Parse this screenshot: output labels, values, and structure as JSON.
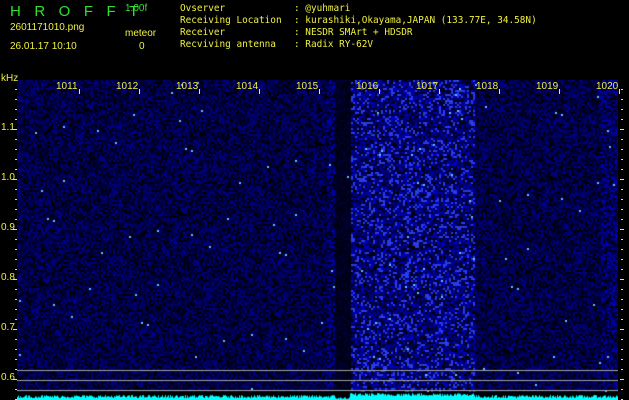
{
  "header": {
    "title": "HROFFT",
    "version": "1.00f",
    "filename": "2601171010.png",
    "datetime": "26.01.17 10:10",
    "meteor_label": "meteor",
    "meteor_count": "0"
  },
  "info": [
    {
      "label": "Ovserver",
      "value": "@yuhmari"
    },
    {
      "label": "Receiving Location",
      "value": "kurashiki,Okayama,JAPAN (133.77E, 34.58N)"
    },
    {
      "label": "Receiver",
      "value": "NESDR SMArt + HDSDR"
    },
    {
      "label": "Recviving antenna",
      "value": "Radix RY-62V"
    }
  ],
  "axes": {
    "y_unit": "kHz",
    "y_ticks": [
      "1.1",
      "1.0",
      "0.9",
      "0.8",
      "0.7",
      "0.6"
    ],
    "x_ticks": [
      "1011",
      "1012",
      "1013",
      "1014",
      "1015",
      "1016",
      "1017",
      "1018",
      "1019",
      "1020"
    ]
  },
  "colors": {
    "title": "#30e030",
    "text": "#f0f040",
    "signal": "#00ffff",
    "noise": "#2020ff"
  }
}
